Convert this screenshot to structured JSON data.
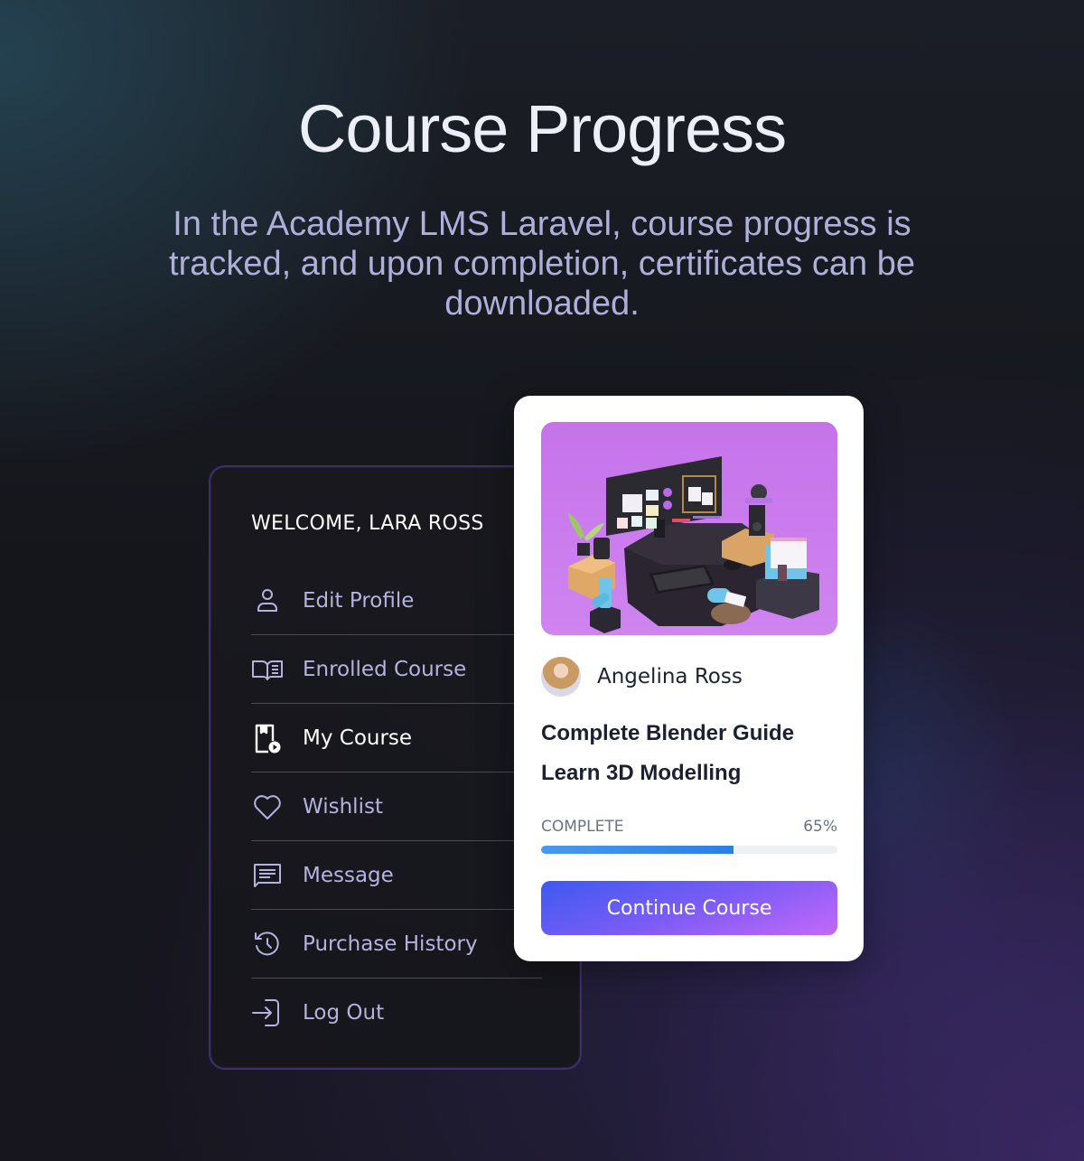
{
  "header": {
    "title": "Course Progress",
    "subtitle": "In the Academy LMS Laravel, course progress is tracked, and upon completion, certificates can be downloaded."
  },
  "menu": {
    "welcome": "WELCOME, LARA ROSS",
    "items": [
      {
        "label": "Edit Profile",
        "icon": "user-icon",
        "active": false
      },
      {
        "label": "Enrolled Course",
        "icon": "open-book-icon",
        "active": false
      },
      {
        "label": "My Course",
        "icon": "course-video-icon",
        "active": true
      },
      {
        "label": "Wishlist",
        "icon": "heart-icon",
        "active": false
      },
      {
        "label": "Message",
        "icon": "message-icon",
        "active": false
      },
      {
        "label": "Purchase History",
        "icon": "history-icon",
        "active": false
      },
      {
        "label": "Log Out",
        "icon": "logout-icon",
        "active": false
      }
    ]
  },
  "course": {
    "thumbnail": "3d-workspace-illustration",
    "instructor": "Angelina Ross",
    "title": "Complete Blender Guide Learn 3D Modelling",
    "progress_label": "COMPLETE",
    "progress_value": "65%",
    "progress_percent": 65,
    "button_label": "Continue Course"
  },
  "colors": {
    "accent_gradient_start": "#3d5af1",
    "accent_gradient_end": "#c468fa",
    "progress_fill": "#2a7fe8",
    "menu_text": "#b4b3e0",
    "menu_border": "#3e2f6c"
  }
}
